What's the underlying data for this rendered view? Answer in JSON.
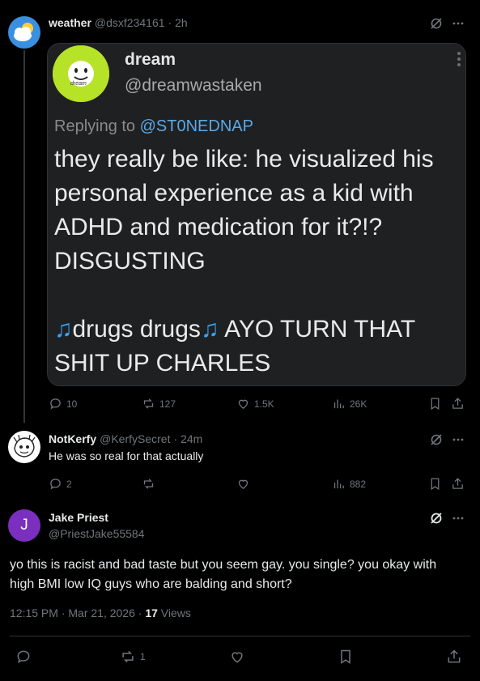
{
  "tweet1": {
    "name": "weather",
    "handle": "@dsxf234161",
    "time": "· 2h",
    "quoted": {
      "name": "dream",
      "handle": "@dreamwastaken",
      "replying_prefix": "Replying to ",
      "replying_to": "@ST0NEDNAP",
      "body_text": "they really be like: he visualized his personal experience as a kid with ADHD and medication for it?!? DISGUSTING",
      "line2_a": "drugs drugs",
      "line2_b": " AYO TURN THAT SHIT UP CHARLES",
      "avatar_text": "dream"
    },
    "stats": {
      "replies": "10",
      "retweets": "127",
      "likes": "1.5K",
      "views": "26K"
    }
  },
  "tweet2": {
    "name": "NotKerfy",
    "handle": "@KerfySecret",
    "time": "· 24m",
    "text": "He was so real for that actually",
    "stats": {
      "replies": "2",
      "retweets": "",
      "likes": "",
      "views": "882"
    }
  },
  "tweet3": {
    "name": "Jake Priest",
    "handle": "@PriestJake55584",
    "avatar_letter": "J",
    "text": "yo this is racist and bad taste but you seem gay. you single? you okay with high BMI low IQ guys who are balding and short?",
    "time": "12:15 PM · Mar 21, 2026 · ",
    "views_count": "17",
    "views_label": " Views",
    "retweets": "1"
  },
  "colors": {
    "background": "#000000",
    "text": "#e7e9ea",
    "muted": "#71767b",
    "divider": "#2f3336",
    "avatar_purple": "#7b2fbe"
  },
  "icons": [
    "grok-icon",
    "more-icon",
    "reply-icon",
    "retweet-icon",
    "like-icon",
    "views-icon",
    "bookmark-icon",
    "share-icon"
  ]
}
